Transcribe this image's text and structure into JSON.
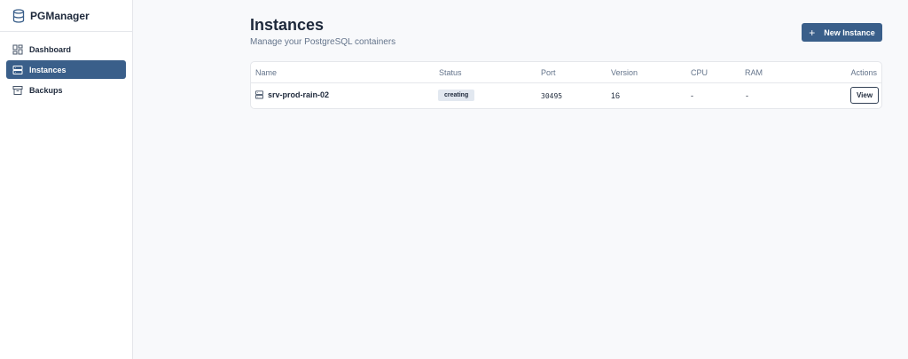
{
  "app": {
    "name": "PGManager"
  },
  "sidebar": {
    "items": [
      {
        "label": "Dashboard",
        "icon": "dashboard-icon",
        "active": false
      },
      {
        "label": "Instances",
        "icon": "server-icon",
        "active": true
      },
      {
        "label": "Backups",
        "icon": "archive-icon",
        "active": false
      }
    ]
  },
  "page": {
    "title": "Instances",
    "subtitle": "Manage your PostgreSQL containers",
    "new_button_label": "New Instance",
    "new_button_icon": "plus-icon"
  },
  "table": {
    "columns": [
      "Name",
      "Status",
      "Port",
      "Version",
      "CPU",
      "RAM",
      "Actions"
    ],
    "rows": [
      {
        "name": "srv-prod-rain-02",
        "status": "creating",
        "port": "30495",
        "version": "16",
        "cpu": "-",
        "ram": "-",
        "action": "View"
      }
    ]
  },
  "colors": {
    "accent": "#3a5f8a",
    "background": "#f8f9fb",
    "badge": "#e2e8f0"
  }
}
